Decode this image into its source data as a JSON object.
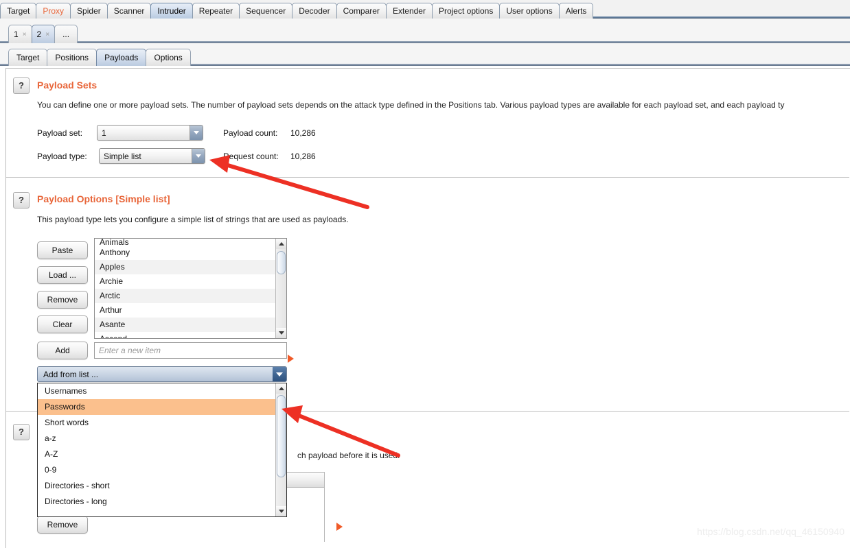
{
  "main_tabs": [
    {
      "label": "Target",
      "selected": false,
      "accent": false
    },
    {
      "label": "Proxy",
      "selected": false,
      "accent": true
    },
    {
      "label": "Spider",
      "selected": false,
      "accent": false
    },
    {
      "label": "Scanner",
      "selected": false,
      "accent": false
    },
    {
      "label": "Intruder",
      "selected": true,
      "accent": false
    },
    {
      "label": "Repeater",
      "selected": false,
      "accent": false
    },
    {
      "label": "Sequencer",
      "selected": false,
      "accent": false
    },
    {
      "label": "Decoder",
      "selected": false,
      "accent": false
    },
    {
      "label": "Comparer",
      "selected": false,
      "accent": false
    },
    {
      "label": "Extender",
      "selected": false,
      "accent": false
    },
    {
      "label": "Project options",
      "selected": false,
      "accent": false
    },
    {
      "label": "User options",
      "selected": false,
      "accent": false
    },
    {
      "label": "Alerts",
      "selected": false,
      "accent": false
    }
  ],
  "attack_tabs": [
    {
      "label": "1",
      "close": "×",
      "selected": false
    },
    {
      "label": "2",
      "close": "×",
      "selected": true
    }
  ],
  "attack_tab_more": "...",
  "sub_tabs": [
    {
      "label": "Target",
      "selected": false
    },
    {
      "label": "Positions",
      "selected": false
    },
    {
      "label": "Payloads",
      "selected": true
    },
    {
      "label": "Options",
      "selected": false
    }
  ],
  "payload_sets": {
    "help_glyph": "?",
    "title": "Payload Sets",
    "description": "You can define one or more payload sets. The number of payload sets depends on the attack type defined in the Positions tab. Various payload types are available for each payload set, and each payload ty",
    "payload_set_label": "Payload set:",
    "payload_set_value": "1",
    "payload_type_label": "Payload type:",
    "payload_type_value": "Simple list",
    "payload_count_label": "Payload count:",
    "payload_count_value": "10,286",
    "request_count_label": "Request count:",
    "request_count_value": "10,286"
  },
  "payload_options": {
    "help_glyph": "?",
    "title": "Payload Options [Simple list]",
    "description": "This payload type lets you configure a simple list of strings that are used as payloads.",
    "buttons": {
      "paste": "Paste",
      "load": "Load ...",
      "remove": "Remove",
      "clear": "Clear",
      "add": "Add"
    },
    "list_items_clipped_top": "Animals",
    "list_items": [
      "Anthony",
      "Apples",
      "Archie",
      "Arctic",
      "Arthur",
      "Asante"
    ],
    "list_items_clipped_bottom": "Ascend",
    "add_input_placeholder": "Enter a new item",
    "add_input_value": "",
    "add_from_list_label": "Add from list ...",
    "add_from_list_options": [
      {
        "label": "Usernames",
        "highlighted": false
      },
      {
        "label": "Passwords",
        "highlighted": true
      },
      {
        "label": "Short words",
        "highlighted": false
      },
      {
        "label": "a-z",
        "highlighted": false
      },
      {
        "label": "A-Z",
        "highlighted": false
      },
      {
        "label": "0-9",
        "highlighted": false
      },
      {
        "label": "Directories - short",
        "highlighted": false
      },
      {
        "label": "Directories - long",
        "highlighted": false
      }
    ]
  },
  "payload_processing": {
    "help_glyph": "?",
    "description_visible_fragment": "ch payload before it is used.",
    "remove_button": "Remove"
  },
  "watermark": "https://blog.csdn.net/qq_46150940",
  "colors": {
    "accent_orange": "#e8663a",
    "annotation_red": "#ed3024",
    "highlight_peach": "#fbc08d",
    "marker_orange": "#f05a28"
  }
}
